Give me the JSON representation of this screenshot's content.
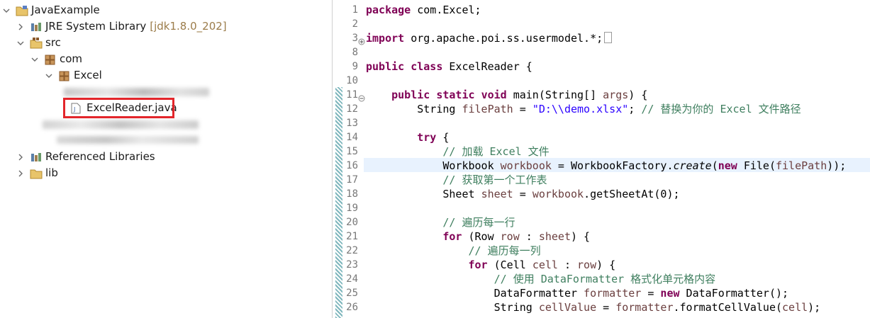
{
  "explorer": {
    "project": "JavaExample",
    "jre_label": "JRE System Library",
    "jre_decoration": "[jdk1.8.0_202]",
    "src": "src",
    "pkg_com": "com",
    "pkg_excel": "Excel",
    "file": "ExcelReader.java",
    "ref_libs": "Referenced Libraries",
    "lib": "lib"
  },
  "editor": {
    "lines": [
      {
        "n": "1",
        "t": [
          {
            "c": "kw",
            "v": "package"
          },
          {
            "c": "",
            "v": " com.Excel;"
          }
        ]
      },
      {
        "n": "2",
        "t": []
      },
      {
        "n": "3",
        "fold": "plus",
        "t": [
          {
            "c": "kw",
            "v": "import"
          },
          {
            "c": "",
            "v": " org.apache.poi.ss.usermodel.*;"
          }
        ],
        "marker": "collapsed"
      },
      {
        "n": "8",
        "t": []
      },
      {
        "n": "9",
        "t": [
          {
            "c": "kw",
            "v": "public"
          },
          {
            "c": "",
            "v": " "
          },
          {
            "c": "kw",
            "v": "class"
          },
          {
            "c": "",
            "v": " ExcelReader {"
          }
        ]
      },
      {
        "n": "10",
        "t": []
      },
      {
        "n": "11",
        "fold": "minus",
        "t": [
          {
            "c": "",
            "v": "    "
          },
          {
            "c": "kw",
            "v": "public"
          },
          {
            "c": "",
            "v": " "
          },
          {
            "c": "kw",
            "v": "static"
          },
          {
            "c": "",
            "v": " "
          },
          {
            "c": "kw",
            "v": "void"
          },
          {
            "c": "",
            "v": " main(String[] "
          },
          {
            "c": "var",
            "v": "args"
          },
          {
            "c": "",
            "v": ") {"
          }
        ]
      },
      {
        "n": "12",
        "t": [
          {
            "c": "",
            "v": "        String "
          },
          {
            "c": "var",
            "v": "filePath"
          },
          {
            "c": "",
            "v": " = "
          },
          {
            "c": "str",
            "v": "\"D:\\\\demo.xlsx\""
          },
          {
            "c": "",
            "v": "; "
          },
          {
            "c": "cm",
            "v": "// 替换为你的 Excel 文件路径"
          }
        ]
      },
      {
        "n": "13",
        "t": []
      },
      {
        "n": "14",
        "t": [
          {
            "c": "",
            "v": "        "
          },
          {
            "c": "kw",
            "v": "try"
          },
          {
            "c": "",
            "v": " {"
          }
        ]
      },
      {
        "n": "15",
        "t": [
          {
            "c": "",
            "v": "            "
          },
          {
            "c": "cm",
            "v": "// 加载 Excel 文件"
          }
        ]
      },
      {
        "n": "16",
        "current": true,
        "t": [
          {
            "c": "",
            "v": "            Workbook "
          },
          {
            "c": "var",
            "v": "workbook"
          },
          {
            "c": "",
            "v": " = WorkbookFactory."
          },
          {
            "c": "it",
            "v": "create"
          },
          {
            "c": "",
            "v": "("
          },
          {
            "c": "kw",
            "v": "new"
          },
          {
            "c": "",
            "v": " File("
          },
          {
            "c": "var",
            "v": "filePath"
          },
          {
            "c": "",
            "v": "));"
          }
        ]
      },
      {
        "n": "17",
        "t": [
          {
            "c": "",
            "v": "            "
          },
          {
            "c": "cm",
            "v": "// 获取第一个工作表"
          }
        ]
      },
      {
        "n": "18",
        "t": [
          {
            "c": "",
            "v": "            Sheet "
          },
          {
            "c": "var",
            "v": "sheet"
          },
          {
            "c": "",
            "v": " = "
          },
          {
            "c": "var",
            "v": "workbook"
          },
          {
            "c": "",
            "v": ".getSheetAt(0);"
          }
        ]
      },
      {
        "n": "19",
        "t": []
      },
      {
        "n": "20",
        "t": [
          {
            "c": "",
            "v": "            "
          },
          {
            "c": "cm",
            "v": "// 遍历每一行"
          }
        ]
      },
      {
        "n": "21",
        "t": [
          {
            "c": "",
            "v": "            "
          },
          {
            "c": "kw",
            "v": "for"
          },
          {
            "c": "",
            "v": " (Row "
          },
          {
            "c": "var",
            "v": "row"
          },
          {
            "c": "",
            "v": " : "
          },
          {
            "c": "var",
            "v": "sheet"
          },
          {
            "c": "",
            "v": ") {"
          }
        ]
      },
      {
        "n": "22",
        "t": [
          {
            "c": "",
            "v": "                "
          },
          {
            "c": "cm",
            "v": "// 遍历每一列"
          }
        ]
      },
      {
        "n": "23",
        "t": [
          {
            "c": "",
            "v": "                "
          },
          {
            "c": "kw",
            "v": "for"
          },
          {
            "c": "",
            "v": " (Cell "
          },
          {
            "c": "var",
            "v": "cell"
          },
          {
            "c": "",
            "v": " : "
          },
          {
            "c": "var",
            "v": "row"
          },
          {
            "c": "",
            "v": ") {"
          }
        ]
      },
      {
        "n": "24",
        "t": [
          {
            "c": "",
            "v": "                    "
          },
          {
            "c": "cm",
            "v": "// 使用 DataFormatter 格式化单元格内容"
          }
        ]
      },
      {
        "n": "25",
        "t": [
          {
            "c": "",
            "v": "                    DataFormatter "
          },
          {
            "c": "var",
            "v": "formatter"
          },
          {
            "c": "",
            "v": " = "
          },
          {
            "c": "kw",
            "v": "new"
          },
          {
            "c": "",
            "v": " DataFormatter();"
          }
        ]
      },
      {
        "n": "26",
        "t": [
          {
            "c": "",
            "v": "                    String "
          },
          {
            "c": "var",
            "v": "cellValue"
          },
          {
            "c": "",
            "v": " = "
          },
          {
            "c": "var",
            "v": "formatter"
          },
          {
            "c": "",
            "v": ".formatCellValue("
          },
          {
            "c": "var",
            "v": "cell"
          },
          {
            "c": "",
            "v": ");"
          }
        ]
      }
    ]
  },
  "colors": {
    "keyword": "#7f0055",
    "string": "#2a00ff",
    "comment": "#3f7f5f",
    "variable": "#6a3e3e",
    "highlight_box": "#e3262b",
    "current_line": "#e8f2fe",
    "change_bar": "#7fb7bd"
  },
  "icons": {
    "project": "project-folder-icon",
    "library": "library-icon",
    "source_folder": "source-folder-icon",
    "package": "package-icon",
    "java_file": "java-file-icon",
    "folder": "folder-icon"
  }
}
